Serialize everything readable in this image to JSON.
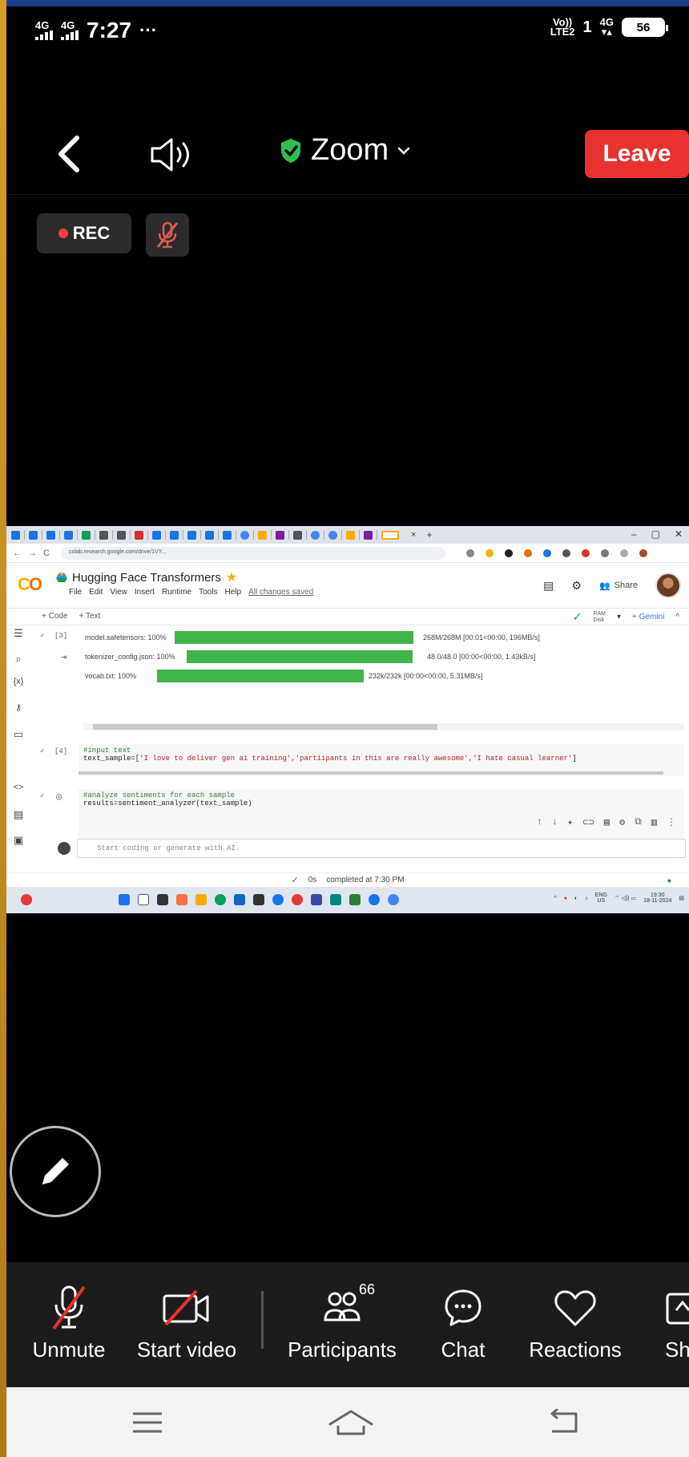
{
  "status_bar": {
    "network1": "4G",
    "network2": "4G",
    "time": "7:27",
    "more_indicator": "···",
    "volte_top": "Vo))",
    "volte_bottom": "LTE2",
    "sim_signal": "1",
    "network_right": "4G",
    "battery": "56"
  },
  "meeting": {
    "title": "Zoom",
    "leave_label": "Leave",
    "rec_label": "REC",
    "shield_color": "#2fbf4f",
    "leave_color": "#e8322f"
  },
  "shared_screen": {
    "url": "colab.research.google.com/drive/1VY...",
    "notebook_title": "Hugging Face Transformers",
    "menu": [
      "File",
      "Edit",
      "View",
      "Insert",
      "Runtime",
      "Tools",
      "Help"
    ],
    "saved_status": "All changes saved",
    "share_label": "Share",
    "toolbar_code": "+ Code",
    "toolbar_text": "+ Text",
    "ram_label": "RAM",
    "disk_label": "Disk",
    "gemini_label": "+ Gemini",
    "cell3_count": "[3]",
    "downloads": [
      {
        "name": "model.safetensors: 100%",
        "stats": "268M/268M [00:01<00:00, 196MB/s]",
        "progress": 1.0
      },
      {
        "name": "tokenizer_config.json: 100%",
        "stats": "48.0/48.0 [00:00<00:00, 1.43kB/s]",
        "progress": 1.0
      },
      {
        "name": "vocab.txt: 100%",
        "stats": "232k/232k [00:00<00:00, 5.31MB/s]",
        "progress": 1.0
      }
    ],
    "cell4_count": "[4]",
    "cell4_comment": "#input text",
    "cell4_code_prefix": "text_sample=[",
    "cell4_strings": "'I love to deliver gen ai training','partiipants in this are really awesome','I hate casual learner'",
    "cell4_code_suffix": "]",
    "cell5_comment": "#analyze sentiments for each sample",
    "cell5_code": "results=sentiment_analyzer(text_sample)",
    "new_cell_placeholder": "Start coding or generate with AI.",
    "exec_time": "0s",
    "completed_status": "completed at 7:30 PM",
    "tray_lang": "ENG",
    "tray_region": "US",
    "tray_time": "19:30",
    "tray_date": "18-11-2024"
  },
  "controls": {
    "unmute": "Unmute",
    "start_video": "Start video",
    "participants": "Participants",
    "participants_count": "66",
    "chat": "Chat",
    "reactions": "Reactions",
    "share": "Sh"
  }
}
